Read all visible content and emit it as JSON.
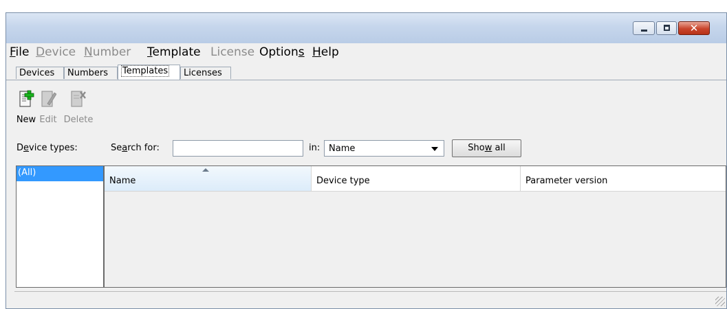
{
  "menu": {
    "file": {
      "label": "File",
      "accel": "F",
      "rest": "ile"
    },
    "device": {
      "label": "Device",
      "accel": "D",
      "rest": "evice"
    },
    "number": {
      "label": "Number",
      "accel": "N",
      "rest": "umber"
    },
    "template": {
      "label": "Template",
      "accel": "T",
      "rest": "emplate"
    },
    "license": {
      "label": "License"
    },
    "options": {
      "label": "Options",
      "pre": "Option",
      "accel": "s"
    },
    "help": {
      "label": "Help",
      "accel": "H",
      "rest": "elp"
    }
  },
  "tabs": [
    {
      "label": "Devices"
    },
    {
      "label": "Numbers"
    },
    {
      "label": "Templates",
      "active": true
    },
    {
      "label": "Licenses"
    }
  ],
  "toolbar": {
    "new": {
      "label": "New",
      "icon": "new-document-icon"
    },
    "edit": {
      "label": "Edit",
      "icon": "edit-document-icon"
    },
    "delete": {
      "label": "Delete",
      "icon": "delete-document-icon"
    }
  },
  "filter": {
    "device_types_label": {
      "pre": "D",
      "accel": "e",
      "rest": "vice types:"
    },
    "search_label": {
      "pre": "Se",
      "accel": "a",
      "rest": "rch for:"
    },
    "search_value": "",
    "in_label": "in:",
    "in_selected": "Name",
    "show_all": {
      "pre": "Sho",
      "accel": "w",
      "rest": " all"
    }
  },
  "device_types": [
    "(All)"
  ],
  "table": {
    "columns": [
      "Name",
      "Device type",
      "Parameter version"
    ],
    "sorted_column": "Name",
    "rows": []
  },
  "colors": {
    "selection": "#3399ff",
    "close_button": "#c9452c"
  }
}
